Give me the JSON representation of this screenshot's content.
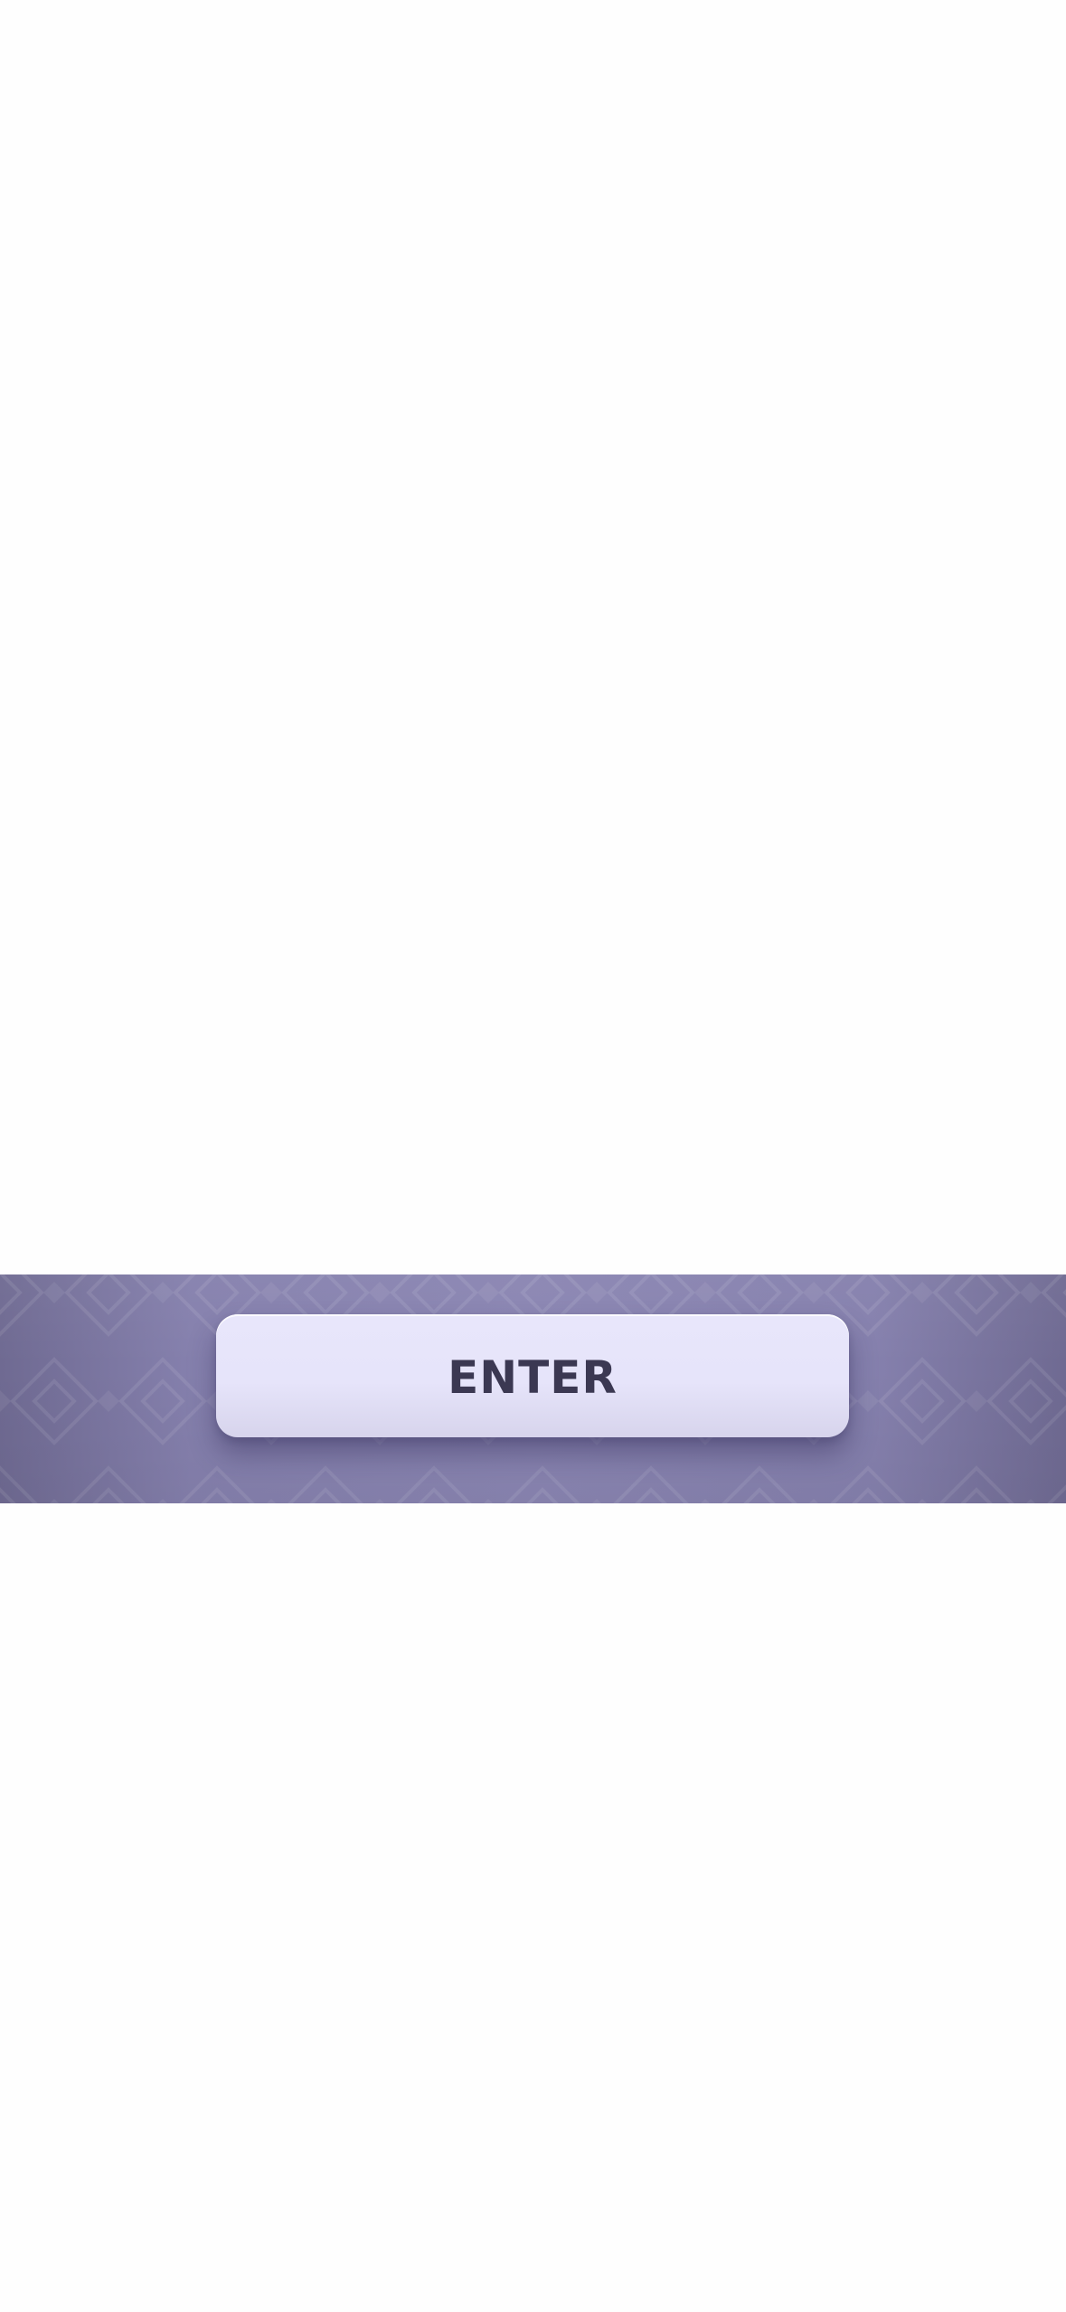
{
  "screen": {
    "background": "#fefefe"
  },
  "banner": {
    "background_color": "#8580ad",
    "pattern_icon": "diamond-pattern",
    "enter_button": {
      "label": "ENTER",
      "background_color": "#e6e4fa",
      "text_color": "#3b3852"
    }
  }
}
